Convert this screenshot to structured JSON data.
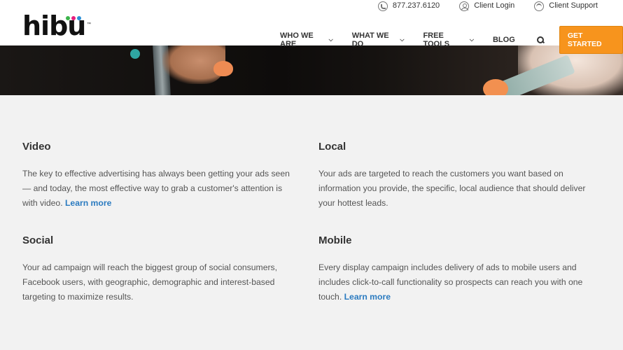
{
  "brand": {
    "logo_text": "hibu",
    "dot_colors": [
      "#3cb44b",
      "#e61e7d",
      "#2b8fd6"
    ]
  },
  "utility": {
    "phone": "877.237.6120",
    "client_login": "Client Login",
    "client_support": "Client Support"
  },
  "nav": {
    "items": [
      {
        "label": "WHO WE ARE",
        "has_dropdown": true
      },
      {
        "label": "WHAT WE DO",
        "has_dropdown": true
      },
      {
        "label": "FREE TOOLS",
        "has_dropdown": true
      },
      {
        "label": "BLOG",
        "has_dropdown": false
      }
    ],
    "cta_label": "GET STARTED",
    "cta_color": "#f7941d"
  },
  "features": {
    "video": {
      "title": "Video",
      "body": "The key to effective advertising has always been getting your ads seen — and today, the most effective way to grab a customer's attention is with video.",
      "link": "Learn more"
    },
    "local": {
      "title": "Local",
      "body": "Your ads are targeted to reach the customers you want based on information you provide, the specific, local audience that should deliver your hottest leads."
    },
    "social": {
      "title": "Social",
      "body": "Your ad campaign will reach the biggest group of social consumers, Facebook users, with geographic, demographic and interest-based targeting to maximize results."
    },
    "mobile": {
      "title": "Mobile",
      "body": "Every display campaign includes delivery of ads to mobile users and includes click-to-call functionality so prospects can reach you with one touch.",
      "link": "Learn more"
    }
  },
  "colors": {
    "link": "#2b7bc0",
    "background": "#f2f2f2"
  }
}
